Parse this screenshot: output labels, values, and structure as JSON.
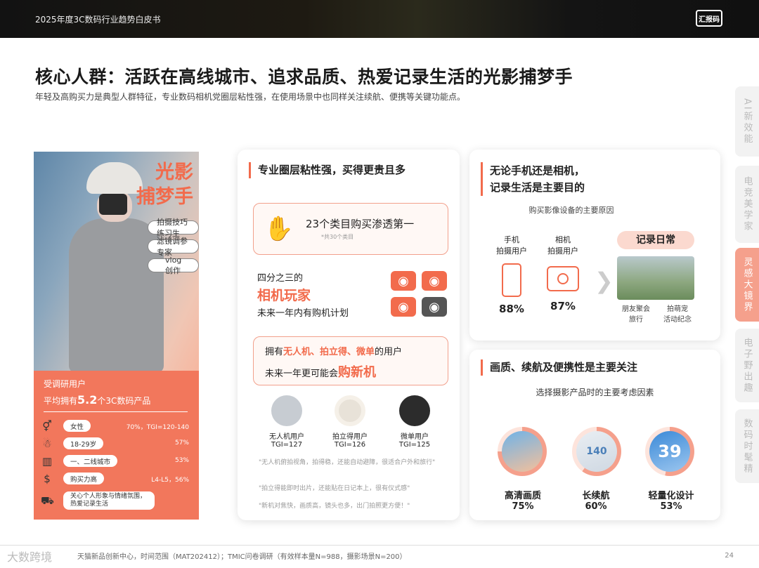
{
  "header": {
    "report_title": "2025年度3C数码行业趋势白皮书",
    "logo": "汇报码"
  },
  "title": "核心人群：活跃在高线城市、追求品质、热爱记录生活的光影捕梦手",
  "subtitle": "年轻及高购买力是典型人群特征，专业数码相机党圈层粘性强，在使用场景中也同样关注续航、便携等关键功能点。",
  "side_tabs": [
    {
      "label": "AI新效能",
      "active": false
    },
    {
      "label": "电竞美学家",
      "active": false
    },
    {
      "label": "灵感大镜界",
      "active": true
    },
    {
      "label": "电子野出趣",
      "active": false
    },
    {
      "label": "数码时髦精",
      "active": false
    }
  ],
  "persona": {
    "title_line1": "光影",
    "title_line2": "捕梦手",
    "tags": [
      "拍摄技巧练习生",
      "滤镜调参专家",
      "vlog创作"
    ],
    "stats_line1": "受调研用户",
    "stats_line2_pre": "平均拥有",
    "stats_line2_num": "5.2",
    "stats_line2_post": "个3C数码产品",
    "rows": [
      {
        "icon": "gender-icon",
        "glyph": "⚥",
        "label": "女性",
        "value": "70%，TGI=120-140"
      },
      {
        "icon": "person-icon",
        "glyph": "☃",
        "label": "18-29岁",
        "value": "57%"
      },
      {
        "icon": "city-icon",
        "glyph": "▥",
        "label": "一、二线城市",
        "value": "53%"
      },
      {
        "icon": "money-icon",
        "glyph": "$",
        "label": "购买力高",
        "value": "L4-L5，56%"
      },
      {
        "icon": "cart-icon",
        "glyph": "⛟",
        "label": "关心个人形象与情绪氛围，热爱记录生活",
        "value": ""
      }
    ]
  },
  "card1": {
    "heading": "专业圈层粘性强，买得更贵且多",
    "box1_title": "23个类目购买渗透第一",
    "box1_note": "*共30个类目",
    "players_line1": "四分之三的",
    "players_line2": "相机玩家",
    "players_line3": "未来一年内有购机计划",
    "box2_pre": "拥有",
    "box2_hl": "无人机、拍立得、微单",
    "box2_post": "的用户",
    "box2_line2_pre": "未来一年更可能会",
    "box2_line2_hl": "购新机",
    "products": [
      {
        "name": "无人机用户",
        "tgi": "TGI=127",
        "icon": "drone-icon"
      },
      {
        "name": "拍立得用户",
        "tgi": "TGI=126",
        "icon": "instant-camera-icon"
      },
      {
        "name": "微单用户",
        "tgi": "TGI=125",
        "icon": "mirrorless-camera-icon"
      }
    ],
    "quotes": [
      "\"无人机俯拍视角，拍得稳，还能自动避障，很适合户外和旅行\"",
      "\"拍立得能即时出片，还能贴在日记本上，很有仪式感\"",
      "\"新机对焦快，画质高，镜头也多，出门拍照更方便！\""
    ]
  },
  "card2": {
    "heading_line1": "无论手机还是相机，",
    "heading_line2": "记录生活是主要目的",
    "caption": "购买影像设备的主要原因",
    "devices": [
      {
        "label_line1": "手机",
        "label_line2": "拍摄用户",
        "value": "88%",
        "icon": "phone-icon"
      },
      {
        "label_line1": "相机",
        "label_line2": "拍摄用户",
        "value": "87%",
        "icon": "camera-icon"
      }
    ],
    "badge": "记录日常",
    "occasions": [
      {
        "line1": "朋友聚会",
        "line2": "旅行"
      },
      {
        "line1": "拍萌宠",
        "line2": "活动纪念"
      }
    ]
  },
  "card3": {
    "heading": "画质、续航及便携性是主要关注",
    "caption": "选择摄影产品时的主要考虑因素",
    "factors": [
      {
        "label": "高清画质",
        "value": "75%",
        "fraction": 0.75,
        "icon": "photo-quality-icon"
      },
      {
        "label": "长续航",
        "value": "60%",
        "fraction": 0.6,
        "icon": "battery-icon"
      },
      {
        "label": "轻量化设计",
        "value": "53%",
        "fraction": 0.53,
        "icon": "lightweight-icon"
      }
    ],
    "ring_num_1": "140",
    "ring_num_2": "39"
  },
  "footer": {
    "source": "天猫新品创新中心，时间范围（MAT202412）；TMIC问卷调研（有效样本量N=988，摄影场景N=200）",
    "page": "24",
    "watermark": "大数跨境"
  },
  "colors": {
    "accent": "#f26b4c",
    "accent_light": "#f5a08c",
    "panel": "#f2775c"
  }
}
